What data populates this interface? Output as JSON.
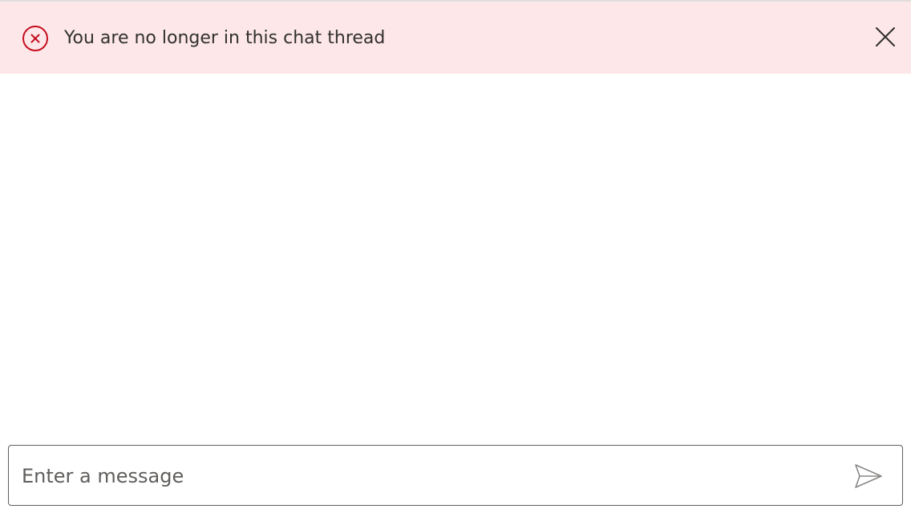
{
  "banner": {
    "message": "You are no longer in this chat thread",
    "icon": "error-circle-icon",
    "close_icon": "close-icon",
    "background": "#fde7e9",
    "icon_color": "#c50f1f"
  },
  "composer": {
    "placeholder": "Enter a message",
    "value": "",
    "send_icon": "send-icon"
  }
}
